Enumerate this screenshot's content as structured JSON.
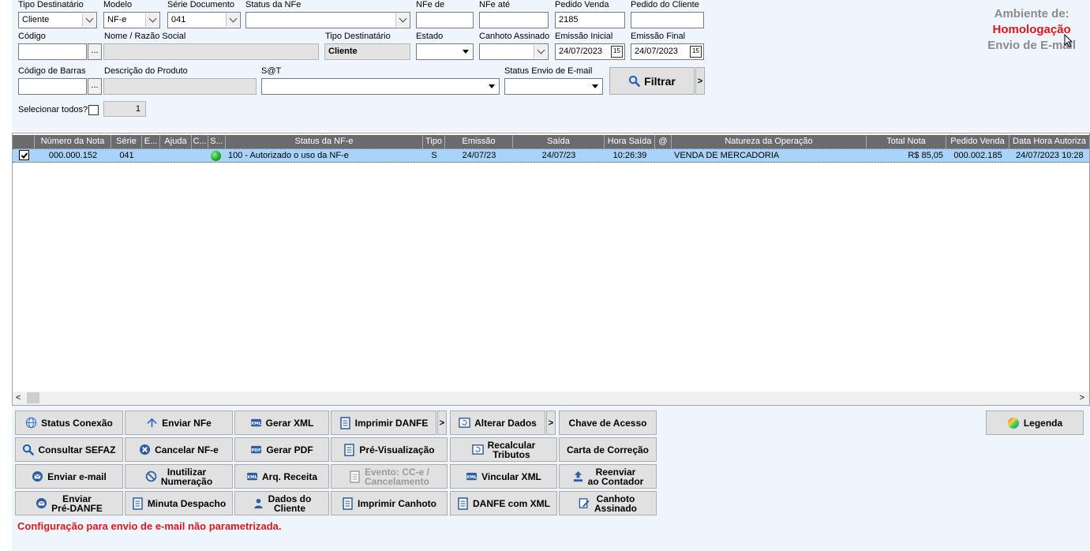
{
  "filters": {
    "tipo_destinatario": {
      "label": "Tipo Destinatário",
      "value": "Cliente"
    },
    "modelo": {
      "label": "Modelo",
      "value": "NF-e"
    },
    "serie_documento": {
      "label": "Série Documento",
      "value": "041"
    },
    "status_nfe": {
      "label": "Status da NFe",
      "value": ""
    },
    "nfe_de": {
      "label": "NFe de",
      "value": ""
    },
    "nfe_ate": {
      "label": "NFe até",
      "value": ""
    },
    "pedido_venda": {
      "label": "Pedido Venda",
      "value": "2185"
    },
    "pedido_cliente": {
      "label": "Pedido do Cliente",
      "value": ""
    },
    "codigo": {
      "label": "Código",
      "value": ""
    },
    "nome": {
      "label": "Nome / Razão Social",
      "value": ""
    },
    "tipo_destinatario_ro": {
      "label": "Tipo Destinatário",
      "value": "Cliente"
    },
    "estado": {
      "label": "Estado",
      "value": ""
    },
    "canhoto": {
      "label": "Canhoto Assinado",
      "value": ""
    },
    "emissao_inicial": {
      "label": "Emissão Inicial",
      "value": "24/07/2023"
    },
    "emissao_final": {
      "label": "Emissão Final",
      "value": "24/07/2023"
    },
    "codigo_barras": {
      "label": "Código de Barras",
      "value": ""
    },
    "descricao_produto": {
      "label": "Descrição do Produto",
      "value": ""
    },
    "sat": {
      "label": "S@T",
      "value": ""
    },
    "status_email": {
      "label": "Status Envio de E-mail",
      "value": ""
    },
    "selecionar_todos": {
      "label": "Selecionar todos?",
      "count": "1"
    },
    "ellipsis": "...",
    "filtrar_label": "Filtrar",
    "more_arrow": ">",
    "calendar_glyph": "15"
  },
  "environment": {
    "line1": "Ambiente de:",
    "line2": "Homologação",
    "line3": "Envio de E-mail",
    "colors": {
      "line1": "#8c8c8c",
      "line2": "#e0161d",
      "line3": "#8c8c8c"
    }
  },
  "grid": {
    "columns": [
      "",
      "Número da Nota",
      "Série",
      "E...",
      "Ajuda",
      "C...",
      "S...",
      "Status da NF-e",
      "Tipo",
      "Emissão",
      "Saída",
      "Hora Saída",
      "@",
      "Natureza da Operação",
      "Total Nota",
      "Pedido Venda",
      "Data Hora Autoriza"
    ],
    "rows": [
      {
        "numero": "000.000.152",
        "serie": "041",
        "status": "100 - Autorizado o uso da NF-e",
        "tipo": "S",
        "emissao": "24/07/23",
        "saida": "24/07/23",
        "hora_saida": "10:26:39",
        "natureza": "VENDA DE MERCADORIA",
        "total": "R$ 85,05",
        "pedido": "000.002.185",
        "data_hora": "24/07/2023 10:28"
      }
    ],
    "status_color": "#1fa51f"
  },
  "actions": {
    "status_conexao": "Status Conexão",
    "enviar_nfe": "Enviar NFe",
    "gerar_xml": "Gerar XML",
    "imprimir_danfe": "Imprimir DANFE",
    "alterar_dados": "Alterar Dados",
    "chave_acesso": "Chave de Acesso",
    "legenda": "Legenda",
    "consultar_sefaz": "Consultar SEFAZ",
    "cancelar_nfe": "Cancelar NF-e",
    "gerar_pdf": "Gerar PDF",
    "pre_visualizacao": "Pré-Visualização",
    "recalcular_tributos": "Recalcular\nTributos",
    "carta_correcao": "Carta de Correção",
    "enviar_email": "Enviar e-mail",
    "inutilizar_numeracao": "Inutilizar\nNumeração",
    "arq_receita": "Arq. Receita",
    "evento_cce": "Evento: CC-e /\nCancelamento",
    "vincular_xml": "Vincular XML",
    "reenviar_contador": "Reenviar\nao Contador",
    "enviar_pre_danfe": "Enviar\nPré-DANFE",
    "minuta_despacho": "Minuta Despacho",
    "dados_cliente": "Dados do\nCliente",
    "imprimir_canhoto": "Imprimir Canhoto",
    "danfe_com_xml": "DANFE com XML",
    "canhoto_assinado": "Canhoto\nAssinado",
    "arrow": ">"
  },
  "warning": "Configuração para envio de e-mail não parametrizada.",
  "icon_names": [
    "chevron-down-icon",
    "calendar-icon",
    "search-icon",
    "check-icon",
    "globe-icon",
    "send-icon",
    "xml-icon",
    "document-icon",
    "refresh-icon",
    "upload-icon",
    "color-wheel-icon",
    "close-circle-icon",
    "ban-icon",
    "mail-icon",
    "user-icon",
    "pdf-icon",
    "signature-icon"
  ]
}
